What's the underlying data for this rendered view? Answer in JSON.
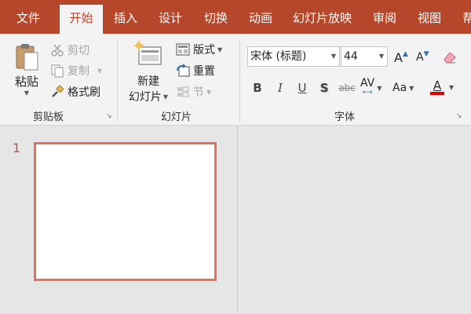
{
  "tabs": [
    {
      "label": "文件",
      "active": false
    },
    {
      "label": "开始",
      "active": true
    },
    {
      "label": "插入",
      "active": false
    },
    {
      "label": "设计",
      "active": false
    },
    {
      "label": "切换",
      "active": false
    },
    {
      "label": "动画",
      "active": false
    },
    {
      "label": "幻灯片放映",
      "active": false
    },
    {
      "label": "审阅",
      "active": false
    },
    {
      "label": "视图",
      "active": false
    },
    {
      "label": "帮",
      "active": false
    }
  ],
  "clipboard": {
    "paste_label": "粘贴",
    "cut_label": "剪切",
    "copy_label": "复制",
    "format_painter_label": "格式刷",
    "group_label": "剪贴板"
  },
  "slides": {
    "new_slide_line1": "新建",
    "new_slide_line2": "幻灯片",
    "layout_label": "版式",
    "reset_label": "重置",
    "section_label": "节",
    "group_label": "幻灯片"
  },
  "font": {
    "font_name": "宋体 (标题)",
    "font_size": "44",
    "grow_label": "A",
    "shrink_label": "A",
    "bold": "B",
    "italic": "I",
    "underline": "U",
    "shadow": "S",
    "strike": "abc",
    "spacing": "AV",
    "change_case": "Aa",
    "font_color": "A",
    "font_color_value": "#e00000",
    "group_label": "字体"
  },
  "slide_pane": {
    "slide_number": "1"
  },
  "colors": {
    "accent": "#b7472a",
    "slide_border": "#e57159"
  }
}
